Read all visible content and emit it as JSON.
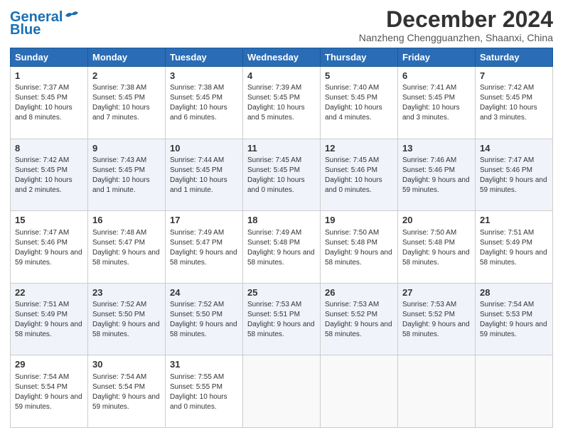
{
  "header": {
    "logo_line1": "General",
    "logo_line2": "Blue",
    "month": "December 2024",
    "location": "Nanzheng Chengguanzhen, Shaanxi, China"
  },
  "weekdays": [
    "Sunday",
    "Monday",
    "Tuesday",
    "Wednesday",
    "Thursday",
    "Friday",
    "Saturday"
  ],
  "weeks": [
    [
      {
        "day": "1",
        "sunrise": "7:37 AM",
        "sunset": "5:45 PM",
        "daylight": "10 hours and 8 minutes."
      },
      {
        "day": "2",
        "sunrise": "7:38 AM",
        "sunset": "5:45 PM",
        "daylight": "10 hours and 7 minutes."
      },
      {
        "day": "3",
        "sunrise": "7:38 AM",
        "sunset": "5:45 PM",
        "daylight": "10 hours and 6 minutes."
      },
      {
        "day": "4",
        "sunrise": "7:39 AM",
        "sunset": "5:45 PM",
        "daylight": "10 hours and 5 minutes."
      },
      {
        "day": "5",
        "sunrise": "7:40 AM",
        "sunset": "5:45 PM",
        "daylight": "10 hours and 4 minutes."
      },
      {
        "day": "6",
        "sunrise": "7:41 AM",
        "sunset": "5:45 PM",
        "daylight": "10 hours and 3 minutes."
      },
      {
        "day": "7",
        "sunrise": "7:42 AM",
        "sunset": "5:45 PM",
        "daylight": "10 hours and 3 minutes."
      }
    ],
    [
      {
        "day": "8",
        "sunrise": "7:42 AM",
        "sunset": "5:45 PM",
        "daylight": "10 hours and 2 minutes."
      },
      {
        "day": "9",
        "sunrise": "7:43 AM",
        "sunset": "5:45 PM",
        "daylight": "10 hours and 1 minute."
      },
      {
        "day": "10",
        "sunrise": "7:44 AM",
        "sunset": "5:45 PM",
        "daylight": "10 hours and 1 minute."
      },
      {
        "day": "11",
        "sunrise": "7:45 AM",
        "sunset": "5:45 PM",
        "daylight": "10 hours and 0 minutes."
      },
      {
        "day": "12",
        "sunrise": "7:45 AM",
        "sunset": "5:46 PM",
        "daylight": "10 hours and 0 minutes."
      },
      {
        "day": "13",
        "sunrise": "7:46 AM",
        "sunset": "5:46 PM",
        "daylight": "9 hours and 59 minutes."
      },
      {
        "day": "14",
        "sunrise": "7:47 AM",
        "sunset": "5:46 PM",
        "daylight": "9 hours and 59 minutes."
      }
    ],
    [
      {
        "day": "15",
        "sunrise": "7:47 AM",
        "sunset": "5:46 PM",
        "daylight": "9 hours and 59 minutes."
      },
      {
        "day": "16",
        "sunrise": "7:48 AM",
        "sunset": "5:47 PM",
        "daylight": "9 hours and 58 minutes."
      },
      {
        "day": "17",
        "sunrise": "7:49 AM",
        "sunset": "5:47 PM",
        "daylight": "9 hours and 58 minutes."
      },
      {
        "day": "18",
        "sunrise": "7:49 AM",
        "sunset": "5:48 PM",
        "daylight": "9 hours and 58 minutes."
      },
      {
        "day": "19",
        "sunrise": "7:50 AM",
        "sunset": "5:48 PM",
        "daylight": "9 hours and 58 minutes."
      },
      {
        "day": "20",
        "sunrise": "7:50 AM",
        "sunset": "5:48 PM",
        "daylight": "9 hours and 58 minutes."
      },
      {
        "day": "21",
        "sunrise": "7:51 AM",
        "sunset": "5:49 PM",
        "daylight": "9 hours and 58 minutes."
      }
    ],
    [
      {
        "day": "22",
        "sunrise": "7:51 AM",
        "sunset": "5:49 PM",
        "daylight": "9 hours and 58 minutes."
      },
      {
        "day": "23",
        "sunrise": "7:52 AM",
        "sunset": "5:50 PM",
        "daylight": "9 hours and 58 minutes."
      },
      {
        "day": "24",
        "sunrise": "7:52 AM",
        "sunset": "5:50 PM",
        "daylight": "9 hours and 58 minutes."
      },
      {
        "day": "25",
        "sunrise": "7:53 AM",
        "sunset": "5:51 PM",
        "daylight": "9 hours and 58 minutes."
      },
      {
        "day": "26",
        "sunrise": "7:53 AM",
        "sunset": "5:52 PM",
        "daylight": "9 hours and 58 minutes."
      },
      {
        "day": "27",
        "sunrise": "7:53 AM",
        "sunset": "5:52 PM",
        "daylight": "9 hours and 58 minutes."
      },
      {
        "day": "28",
        "sunrise": "7:54 AM",
        "sunset": "5:53 PM",
        "daylight": "9 hours and 59 minutes."
      }
    ],
    [
      {
        "day": "29",
        "sunrise": "7:54 AM",
        "sunset": "5:54 PM",
        "daylight": "9 hours and 59 minutes."
      },
      {
        "day": "30",
        "sunrise": "7:54 AM",
        "sunset": "5:54 PM",
        "daylight": "9 hours and 59 minutes."
      },
      {
        "day": "31",
        "sunrise": "7:55 AM",
        "sunset": "5:55 PM",
        "daylight": "10 hours and 0 minutes."
      },
      null,
      null,
      null,
      null
    ]
  ]
}
